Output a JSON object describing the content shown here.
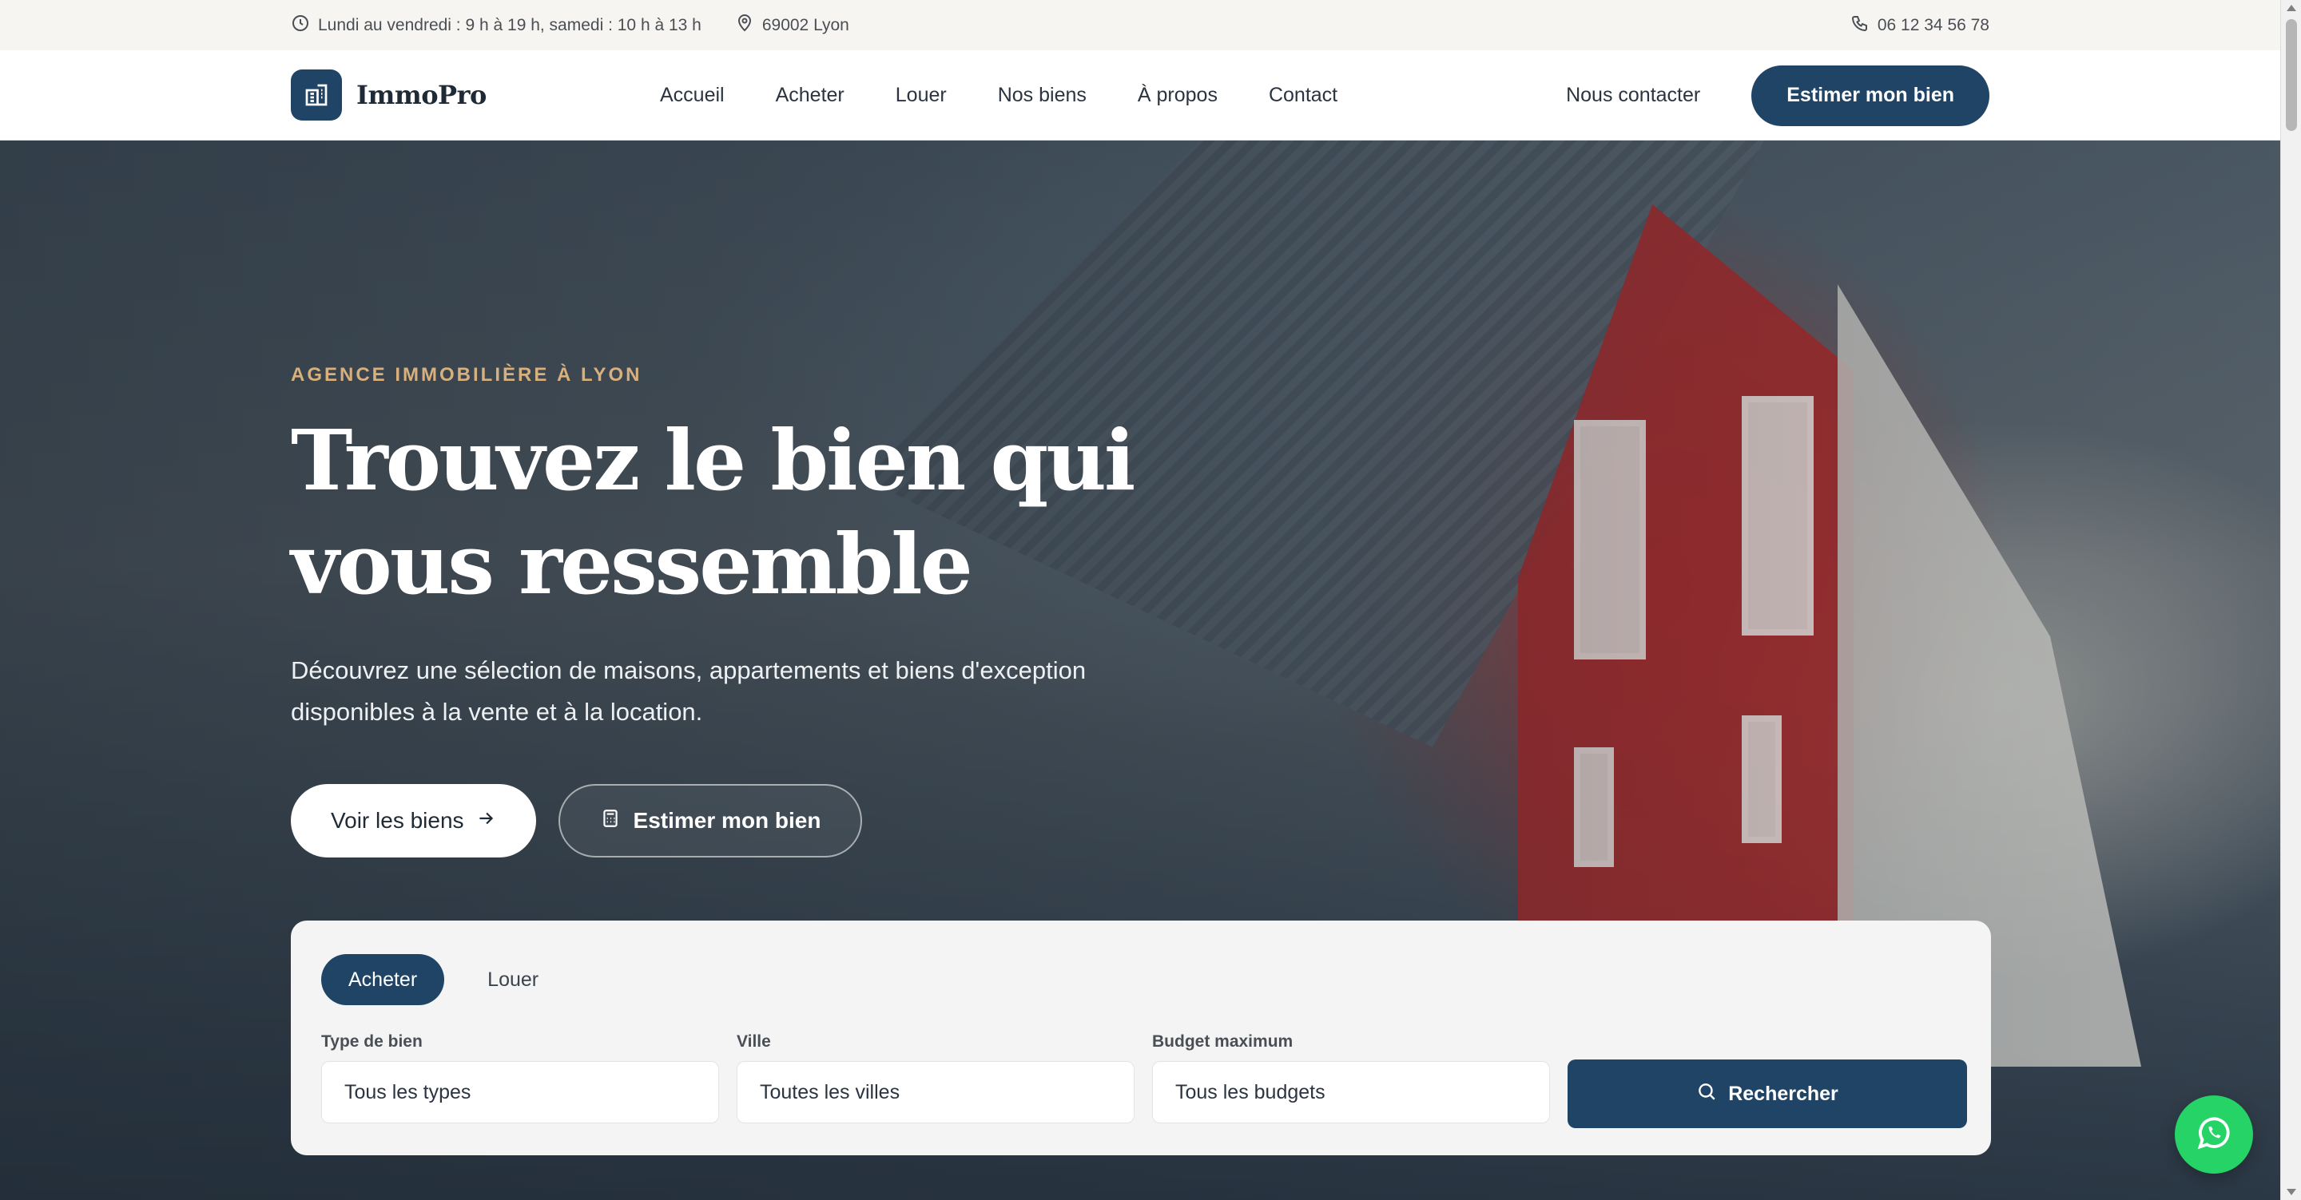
{
  "topbar": {
    "hours": "Lundi au vendredi : 9 h à 19 h, samedi : 10 h à 13 h",
    "location": "69002 Lyon",
    "phone": "06 12 34 56 78"
  },
  "header": {
    "brand": "ImmoPro",
    "nav": [
      "Accueil",
      "Acheter",
      "Louer",
      "Nos biens",
      "À propos",
      "Contact"
    ],
    "contact_link": "Nous contacter",
    "cta": "Estimer mon bien"
  },
  "hero": {
    "eyebrow": "AGENCE IMMOBILIÈRE À LYON",
    "title": "Trouvez le bien qui vous ressemble",
    "subtitle": "Découvrez une sélection de maisons, appartements et biens d'exception disponibles à la vente et à la location.",
    "primary_button": "Voir les biens",
    "secondary_button": "Estimer mon bien"
  },
  "search": {
    "tabs": [
      {
        "label": "Acheter",
        "active": true
      },
      {
        "label": "Louer",
        "active": false
      }
    ],
    "fields": [
      {
        "label": "Type de bien",
        "value": "Tous les types"
      },
      {
        "label": "Ville",
        "value": "Toutes les villes"
      },
      {
        "label": "Budget maximum",
        "value": "Tous les budgets"
      }
    ],
    "button": "Rechercher"
  },
  "colors": {
    "primary": "#1f4466",
    "accent": "#d7b07d",
    "whatsapp": "#25d366"
  },
  "icons": {
    "hours": "clock-icon",
    "location": "map-pin-icon",
    "phone": "phone-icon",
    "brand": "building-icon",
    "arrow": "arrow-right-icon",
    "calculator": "calculator-icon",
    "search": "search-icon",
    "whatsapp": "whatsapp-icon"
  }
}
